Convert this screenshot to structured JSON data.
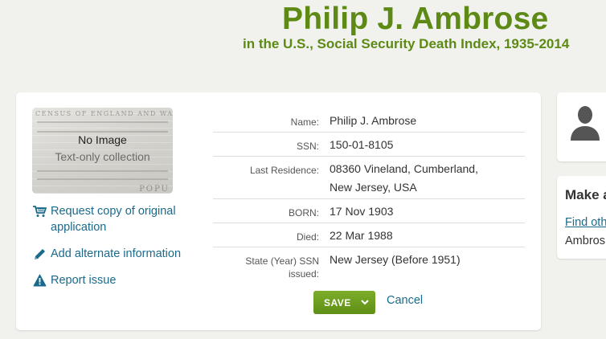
{
  "header": {
    "name": "Philip J. Ambrose",
    "subtitle": "in the U.S., Social Security Death Index, 1935-2014"
  },
  "image_panel": {
    "no_image": "No Image",
    "text_only": "Text-only collection",
    "doc_header": "CENSUS OF ENGLAND AND WALES.",
    "doc_footer": "POPU"
  },
  "actions": {
    "request_copy": "Request copy of original application",
    "add_alternate": "Add alternate information",
    "report_issue": "Report issue"
  },
  "record": [
    {
      "label": "Name:",
      "value": "Philip J. Ambrose"
    },
    {
      "label": "SSN:",
      "value": "150-01-8105"
    },
    {
      "label": "Last Residence:",
      "value": "08360 Vineland, Cumberland, New Jersey, USA"
    },
    {
      "label": "BORN:",
      "value": "17 Nov 1903"
    },
    {
      "label": "Died:",
      "value": "22 Mar 1988"
    },
    {
      "label": "State (Year) SSN issued:",
      "value": "New Jersey (Before 1951)"
    }
  ],
  "buttons": {
    "save": "SAVE",
    "cancel": "Cancel"
  },
  "sidebar": {
    "make_title": "Make a",
    "find_link": "Find oth",
    "name_partial": "Ambros"
  },
  "colors": {
    "brand_green": "#5d8a15",
    "link_blue": "#1a6a8c",
    "save_green": "#6f9f1f"
  }
}
